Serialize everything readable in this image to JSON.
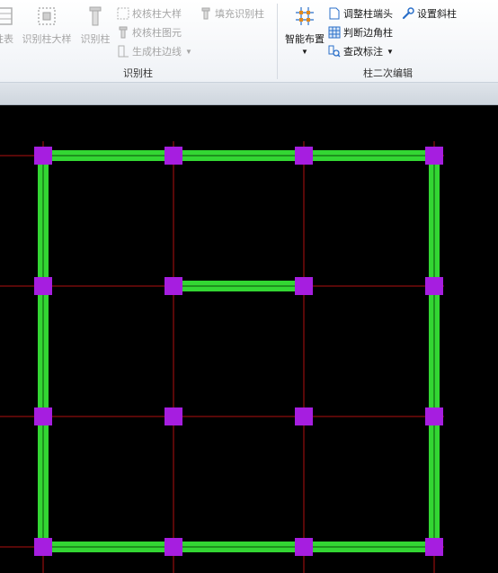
{
  "ribbon": {
    "group_recognize": {
      "label": "识别柱",
      "buttons": {
        "column_table": "柱表",
        "recognize_column_detail": "识别柱大样",
        "recognize_column": "识别柱"
      },
      "small": {
        "check_detail": "校核柱大样",
        "check_primitive": "校核柱图元",
        "generate_edge": "生成柱边线",
        "fill_recognize": "填充识别柱"
      }
    },
    "group_secondary": {
      "label": "柱二次编辑",
      "buttons": {
        "smart_layout": "智能布置"
      },
      "small": {
        "adjust_end": "调整柱端头",
        "judge_corner": "判断边角柱",
        "edit_label": "查改标注",
        "set_inclined": "设置斜柱"
      }
    }
  },
  "colors": {
    "wall": "#33d633",
    "column": "#a61ee0",
    "axis": "#b01010",
    "accent_blue": "#2a6fc9"
  }
}
